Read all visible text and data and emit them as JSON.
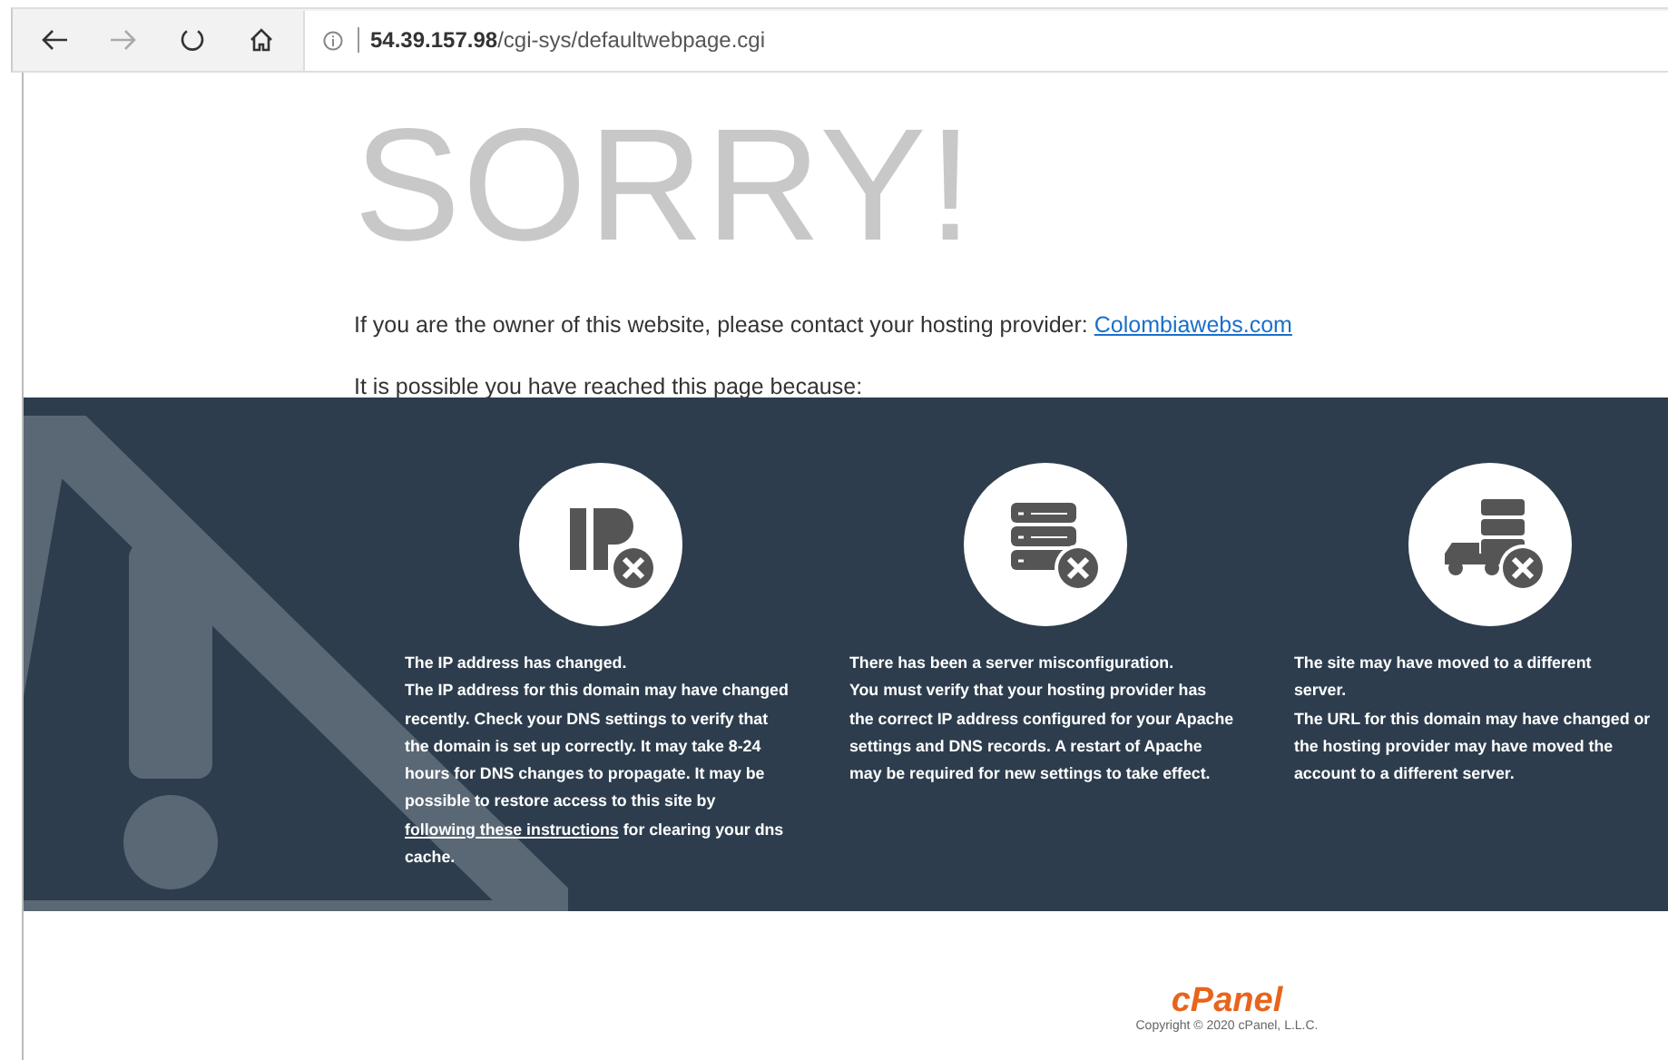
{
  "browser": {
    "address_host": "54.39.157.98",
    "address_path": "/cgi-sys/defaultwebpage.cgi",
    "back_enabled": true,
    "forward_enabled": false
  },
  "page": {
    "heading": "SORRY!",
    "owner_text": "If you are the owner of this website, please contact your hosting provider: ",
    "owner_link": "Colombiawebs.com",
    "reason_intro": "It is possible you have reached this page because:",
    "reasons": [
      {
        "kind": "ip",
        "title": "The IP address has changed.",
        "text": "The IP address for this domain may have changed recently. Check your DNS settings to verify that the domain is set up correctly. It may take 8-24 hours for DNS changes to propagate. It may be possible to restore access to this site by ",
        "link": "following these instructions",
        "text_after": " for clearing your dns cache."
      },
      {
        "kind": "server",
        "title": "There has been a server misconfiguration.",
        "text": "You must verify that your hosting provider has the correct IP address configured for your Apache settings and DNS records. A restart of Apache may be required for new settings to take effect."
      },
      {
        "kind": "moved",
        "title": "The site may have moved to a different server.",
        "text": "The URL for this domain may have changed or the hosting provider may have moved the account to a different server."
      }
    ],
    "footer_logo": "cPanel",
    "copyright": "Copyright © 2020 cPanel, L.L.C."
  }
}
